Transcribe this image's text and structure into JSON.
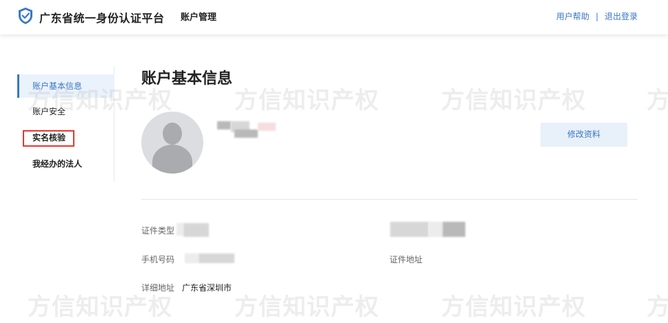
{
  "header": {
    "brand": "广东省统一身份认证平台",
    "nav_title": "账户管理",
    "help_link": "用户帮助",
    "separator": "|",
    "logout_link": "退出登录"
  },
  "sidebar": {
    "items": [
      {
        "label": "账户基本信息",
        "active": true
      },
      {
        "label": "账户安全"
      },
      {
        "label": "实名核验"
      },
      {
        "label": "我经办的法人"
      }
    ]
  },
  "main": {
    "title": "账户基本信息",
    "edit_button": "修改资料",
    "fields": {
      "id_type_label": "证件类型",
      "phone_label": "手机号码",
      "id_address_label": "证件地址",
      "detail_address_label": "详细地址",
      "detail_address_value": "广东省深圳市"
    }
  },
  "watermark": "方信知识产权",
  "colors": {
    "accent": "#3a78c4",
    "active_bg": "#eaf2fc",
    "button_bg": "#e8f0fa",
    "highlight": "#e8362d"
  }
}
